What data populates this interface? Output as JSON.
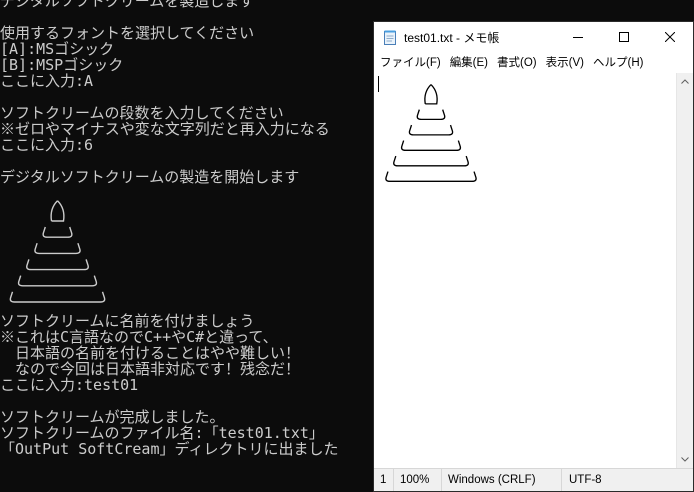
{
  "console": {
    "lines": [
      "デジタルソフトクリームを製造します",
      "",
      "使用するフォントを選択してください",
      "[A]:MSゴシック",
      "[B]:MSPゴシック",
      "ここに入力:A",
      "",
      "ソフトクリームの段数を入力してください",
      "※ゼロやマイナスや変な文字列だと再入力になる",
      "ここに入力:6",
      "",
      "デジタルソフトクリームの製造を開始します",
      "",
      "",
      "",
      "",
      "",
      "",
      "",
      "",
      "ソフトクリームに名前を付けましょう",
      "※これはC言語なのでC++やC#と違って、",
      "　日本語の名前を付けることはやや難しい！",
      "　なので今回は日本語非対応です！残念だ！",
      "ここに入力:test01",
      "",
      "ソフトクリームが完成しました。",
      "ソフトクリームのファイル名:「test01.txt」",
      "「OutPut_SoftCream」ディレクトリに出ました"
    ],
    "cream_tiers": 6
  },
  "notepad": {
    "title": "test01.txt - メモ帳",
    "icon": "notepad-icon",
    "window_controls": {
      "minimize": "minimize-icon",
      "maximize": "maximize-icon",
      "close": "close-icon"
    },
    "menu": [
      "ファイル(F)",
      "編集(E)",
      "書式(O)",
      "表示(V)",
      "ヘルプ(H)"
    ],
    "content_tiers": 6,
    "status": {
      "position": "1",
      "zoom": "100%",
      "line_ending": "Windows (CRLF)",
      "encoding": "UTF-8"
    }
  },
  "colors": {
    "console_bg": "#0c0c0c",
    "console_text": "#cccccc",
    "notepad_bg": "#ffffff",
    "statusbar_bg": "#f0f0f0"
  }
}
